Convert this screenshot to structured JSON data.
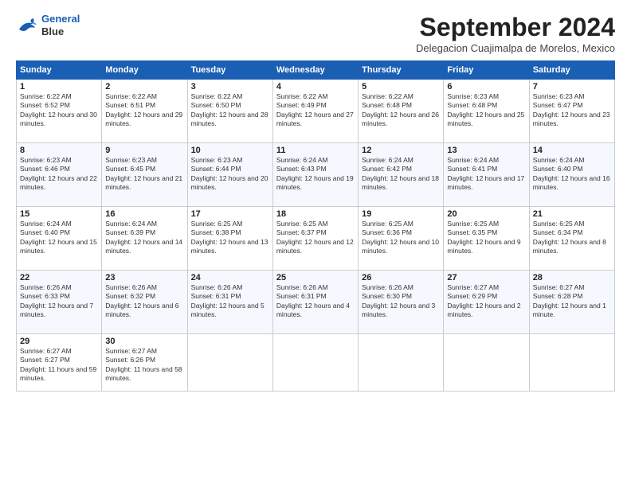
{
  "logo": {
    "line1": "General",
    "line2": "Blue"
  },
  "title": "September 2024",
  "subtitle": "Delegacion Cuajimalpa de Morelos, Mexico",
  "weekdays": [
    "Sunday",
    "Monday",
    "Tuesday",
    "Wednesday",
    "Thursday",
    "Friday",
    "Saturday"
  ],
  "weeks": [
    [
      {
        "day": "1",
        "sunrise": "6:22 AM",
        "sunset": "6:52 PM",
        "daylight": "12 hours and 30 minutes."
      },
      {
        "day": "2",
        "sunrise": "6:22 AM",
        "sunset": "6:51 PM",
        "daylight": "12 hours and 29 minutes."
      },
      {
        "day": "3",
        "sunrise": "6:22 AM",
        "sunset": "6:50 PM",
        "daylight": "12 hours and 28 minutes."
      },
      {
        "day": "4",
        "sunrise": "6:22 AM",
        "sunset": "6:49 PM",
        "daylight": "12 hours and 27 minutes."
      },
      {
        "day": "5",
        "sunrise": "6:22 AM",
        "sunset": "6:48 PM",
        "daylight": "12 hours and 26 minutes."
      },
      {
        "day": "6",
        "sunrise": "6:23 AM",
        "sunset": "6:48 PM",
        "daylight": "12 hours and 25 minutes."
      },
      {
        "day": "7",
        "sunrise": "6:23 AM",
        "sunset": "6:47 PM",
        "daylight": "12 hours and 23 minutes."
      }
    ],
    [
      {
        "day": "8",
        "sunrise": "6:23 AM",
        "sunset": "6:46 PM",
        "daylight": "12 hours and 22 minutes."
      },
      {
        "day": "9",
        "sunrise": "6:23 AM",
        "sunset": "6:45 PM",
        "daylight": "12 hours and 21 minutes."
      },
      {
        "day": "10",
        "sunrise": "6:23 AM",
        "sunset": "6:44 PM",
        "daylight": "12 hours and 20 minutes."
      },
      {
        "day": "11",
        "sunrise": "6:24 AM",
        "sunset": "6:43 PM",
        "daylight": "12 hours and 19 minutes."
      },
      {
        "day": "12",
        "sunrise": "6:24 AM",
        "sunset": "6:42 PM",
        "daylight": "12 hours and 18 minutes."
      },
      {
        "day": "13",
        "sunrise": "6:24 AM",
        "sunset": "6:41 PM",
        "daylight": "12 hours and 17 minutes."
      },
      {
        "day": "14",
        "sunrise": "6:24 AM",
        "sunset": "6:40 PM",
        "daylight": "12 hours and 16 minutes."
      }
    ],
    [
      {
        "day": "15",
        "sunrise": "6:24 AM",
        "sunset": "6:40 PM",
        "daylight": "12 hours and 15 minutes."
      },
      {
        "day": "16",
        "sunrise": "6:24 AM",
        "sunset": "6:39 PM",
        "daylight": "12 hours and 14 minutes."
      },
      {
        "day": "17",
        "sunrise": "6:25 AM",
        "sunset": "6:38 PM",
        "daylight": "12 hours and 13 minutes."
      },
      {
        "day": "18",
        "sunrise": "6:25 AM",
        "sunset": "6:37 PM",
        "daylight": "12 hours and 12 minutes."
      },
      {
        "day": "19",
        "sunrise": "6:25 AM",
        "sunset": "6:36 PM",
        "daylight": "12 hours and 10 minutes."
      },
      {
        "day": "20",
        "sunrise": "6:25 AM",
        "sunset": "6:35 PM",
        "daylight": "12 hours and 9 minutes."
      },
      {
        "day": "21",
        "sunrise": "6:25 AM",
        "sunset": "6:34 PM",
        "daylight": "12 hours and 8 minutes."
      }
    ],
    [
      {
        "day": "22",
        "sunrise": "6:26 AM",
        "sunset": "6:33 PM",
        "daylight": "12 hours and 7 minutes."
      },
      {
        "day": "23",
        "sunrise": "6:26 AM",
        "sunset": "6:32 PM",
        "daylight": "12 hours and 6 minutes."
      },
      {
        "day": "24",
        "sunrise": "6:26 AM",
        "sunset": "6:31 PM",
        "daylight": "12 hours and 5 minutes."
      },
      {
        "day": "25",
        "sunrise": "6:26 AM",
        "sunset": "6:31 PM",
        "daylight": "12 hours and 4 minutes."
      },
      {
        "day": "26",
        "sunrise": "6:26 AM",
        "sunset": "6:30 PM",
        "daylight": "12 hours and 3 minutes."
      },
      {
        "day": "27",
        "sunrise": "6:27 AM",
        "sunset": "6:29 PM",
        "daylight": "12 hours and 2 minutes."
      },
      {
        "day": "28",
        "sunrise": "6:27 AM",
        "sunset": "6:28 PM",
        "daylight": "12 hours and 1 minute."
      }
    ],
    [
      {
        "day": "29",
        "sunrise": "6:27 AM",
        "sunset": "6:27 PM",
        "daylight": "11 hours and 59 minutes."
      },
      {
        "day": "30",
        "sunrise": "6:27 AM",
        "sunset": "6:26 PM",
        "daylight": "11 hours and 58 minutes."
      },
      null,
      null,
      null,
      null,
      null
    ]
  ]
}
